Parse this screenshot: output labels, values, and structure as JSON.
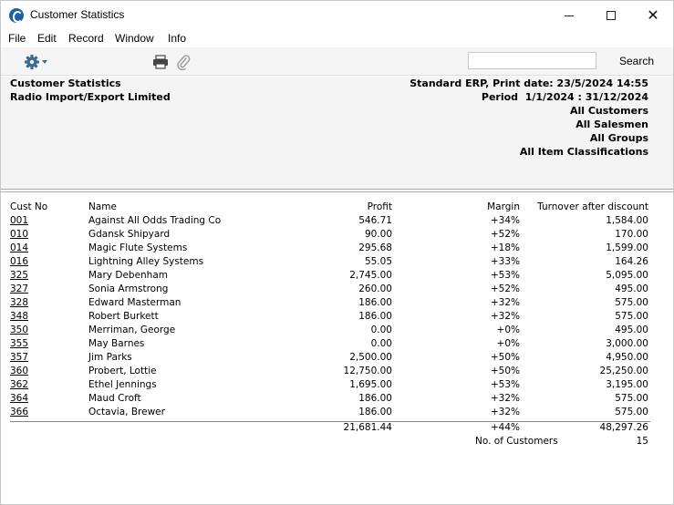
{
  "window": {
    "title": "Customer Statistics",
    "minimize_icon": "minimize-icon",
    "maximize_icon": "maximize-icon",
    "close_glyph": "✕"
  },
  "menu": [
    "File",
    "Edit",
    "Record",
    "Window",
    "Info"
  ],
  "toolbar": {
    "gear_icon": "gear-icon",
    "print_icon": "printer-icon",
    "attach_icon": "paperclip-icon",
    "search_value": "",
    "search_label": "Search"
  },
  "report": {
    "title": "Customer Statistics",
    "company": "Radio Import/Export Limited",
    "system_line": "Standard ERP, Print date: 23/5/2024 14:55",
    "period_line": "Period  1/1/2024 : 31/12/2024",
    "filters": [
      "All Customers",
      "All Salesmen",
      "All Groups",
      "All Item Classifications"
    ]
  },
  "table": {
    "headers": {
      "cust_no": "Cust No",
      "name": "Name",
      "profit": "Profit",
      "margin": "Margin",
      "turnover": "Turnover after discount"
    },
    "rows": [
      {
        "no": "001",
        "name": "Against All Odds Trading Co",
        "profit": "546.71",
        "margin": "+34%",
        "turnover": "1,584.00"
      },
      {
        "no": "010",
        "name": "Gdansk Shipyard",
        "profit": "90.00",
        "margin": "+52%",
        "turnover": "170.00"
      },
      {
        "no": "014",
        "name": "Magic Flute Systems",
        "profit": "295.68",
        "margin": "+18%",
        "turnover": "1,599.00"
      },
      {
        "no": "016",
        "name": "Lightning Alley Systems",
        "profit": "55.05",
        "margin": "+33%",
        "turnover": "164.26"
      },
      {
        "no": "325",
        "name": "Mary Debenham",
        "profit": "2,745.00",
        "margin": "+53%",
        "turnover": "5,095.00"
      },
      {
        "no": "327",
        "name": "Sonia Armstrong",
        "profit": "260.00",
        "margin": "+52%",
        "turnover": "495.00"
      },
      {
        "no": "328",
        "name": "Edward Masterman",
        "profit": "186.00",
        "margin": "+32%",
        "turnover": "575.00"
      },
      {
        "no": "348",
        "name": "Robert Burkett",
        "profit": "186.00",
        "margin": "+32%",
        "turnover": "575.00"
      },
      {
        "no": "350",
        "name": "Merriman, George",
        "profit": "0.00",
        "margin": "+0%",
        "turnover": "495.00"
      },
      {
        "no": "355",
        "name": "May Barnes",
        "profit": "0.00",
        "margin": "+0%",
        "turnover": "3,000.00"
      },
      {
        "no": "357",
        "name": "Jim Parks",
        "profit": "2,500.00",
        "margin": "+50%",
        "turnover": "4,950.00"
      },
      {
        "no": "360",
        "name": "Probert, Lottie",
        "profit": "12,750.00",
        "margin": "+50%",
        "turnover": "25,250.00"
      },
      {
        "no": "362",
        "name": "Ethel Jennings",
        "profit": "1,695.00",
        "margin": "+53%",
        "turnover": "3,195.00"
      },
      {
        "no": "364",
        "name": "Maud Croft",
        "profit": "186.00",
        "margin": "+32%",
        "turnover": "575.00"
      },
      {
        "no": "366",
        "name": "Octavia, Brewer",
        "profit": "186.00",
        "margin": "+32%",
        "turnover": "575.00"
      }
    ],
    "totals": {
      "profit": "21,681.44",
      "margin": "+44%",
      "turnover": "48,297.26"
    },
    "count_label": "No. of Customers",
    "count_value": "15"
  }
}
